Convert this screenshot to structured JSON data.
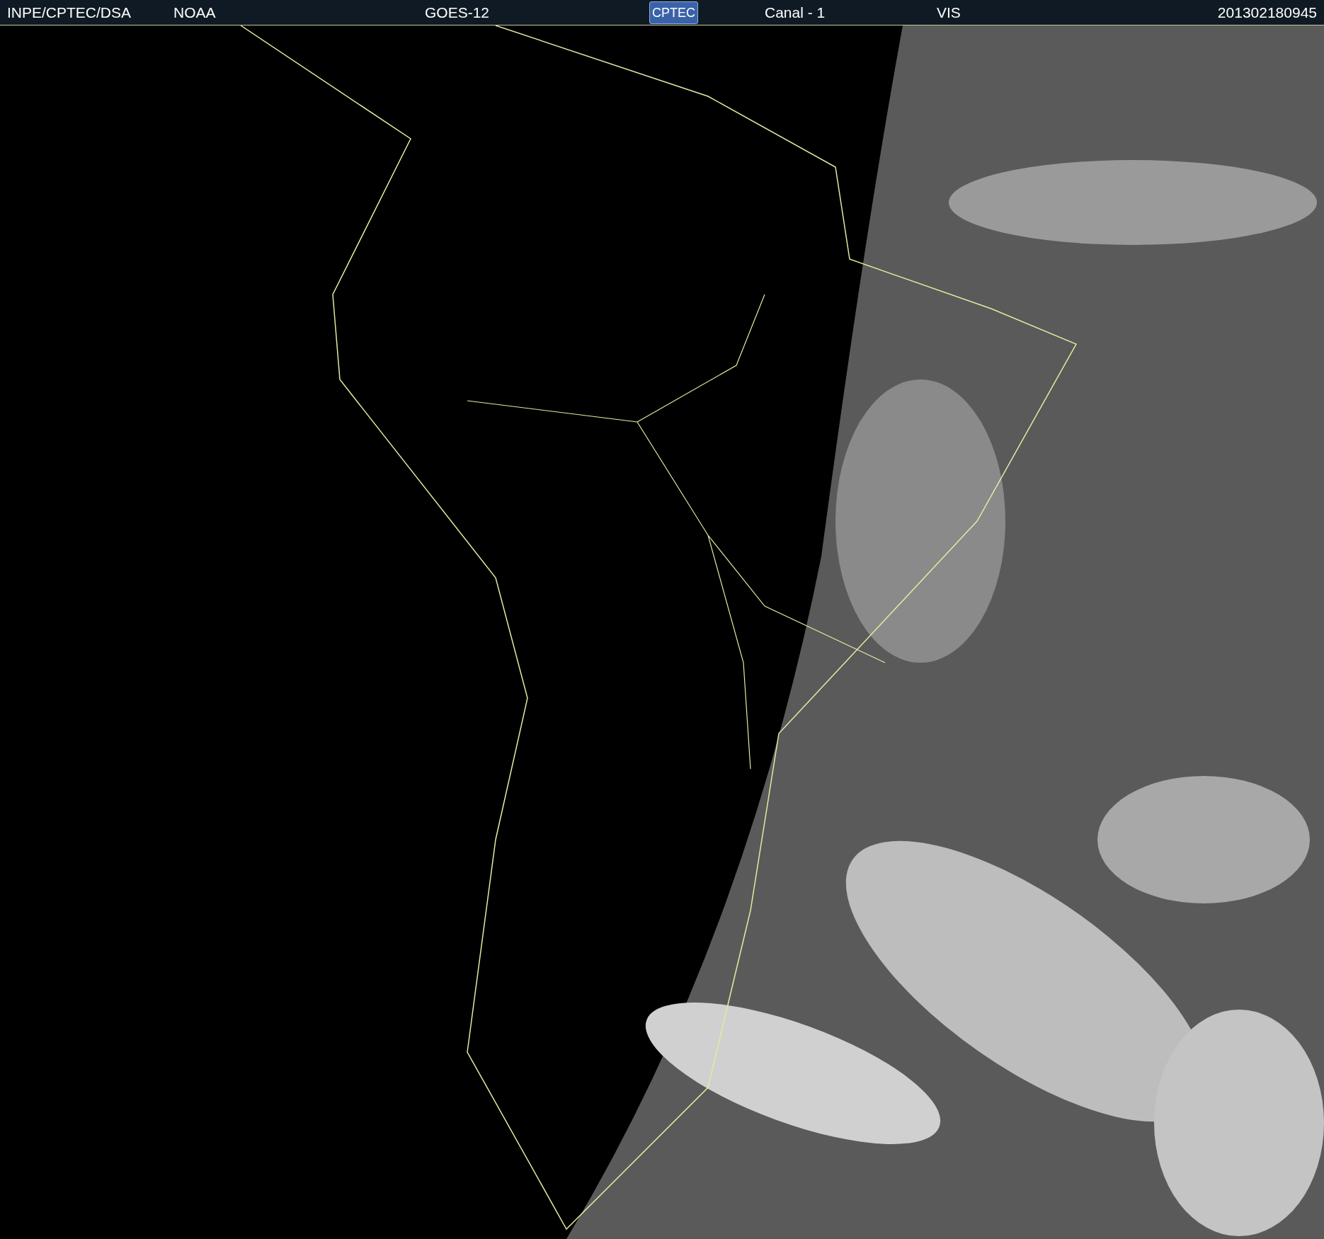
{
  "header": {
    "items": [
      {
        "kind": "text",
        "text": "INPE/CPTEC/DSA"
      },
      {
        "kind": "text",
        "text": "NOAA"
      },
      {
        "kind": "text",
        "text": "GOES-12"
      },
      {
        "kind": "logo",
        "text": "CPTEC"
      },
      {
        "kind": "text",
        "text": "Canal - 1"
      },
      {
        "kind": "text",
        "text": "VIS"
      },
      {
        "kind": "text",
        "text": "201302180945"
      }
    ]
  }
}
